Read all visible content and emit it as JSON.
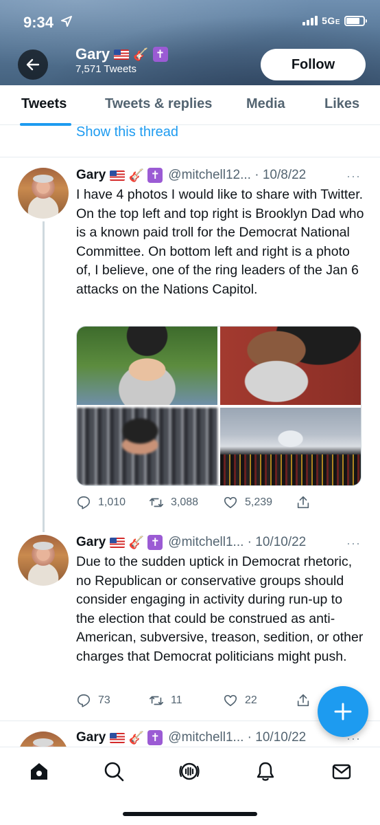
{
  "status_bar": {
    "time": "9:34",
    "network": "5G",
    "network_suffix": "E"
  },
  "profile": {
    "name": "Gary",
    "tweet_count": "7,571 Tweets",
    "follow_label": "Follow"
  },
  "tabs": [
    {
      "label": "Tweets",
      "active": true
    },
    {
      "label": "Tweets & replies",
      "active": false
    },
    {
      "label": "Media",
      "active": false
    },
    {
      "label": "Likes",
      "active": false
    }
  ],
  "show_thread": "Show this thread",
  "tweets": [
    {
      "name": "Gary",
      "handle": "@mitchell12... · 10/8/22",
      "text": "I have 4 photos I would like to share with Twitter. On the top left and top right is Brooklyn Dad who is a known paid troll for the Democrat National Committee. On bottom left and right is a photo of, I believe, one of the ring leaders of the Jan 6 attacks on the Nations Capitol.",
      "replies": "1,010",
      "retweets": "3,088",
      "likes": "5,239"
    },
    {
      "name": "Gary",
      "handle": "@mitchell1... · 10/10/22",
      "text": "Due to the sudden uptick in Democrat rhetoric, no Republican or conservative groups should consider engaging in activity during run-up to the election that could be construed as anti-American, subversive, treason, sedition, or other charges that Democrat politicians might push.",
      "replies": "73",
      "retweets": "11",
      "likes": "22"
    },
    {
      "name": "Gary",
      "handle": "@mitchell1... · 10/10/22"
    }
  ],
  "more_glyph": "···",
  "colors": {
    "accent": "#1d9bf0",
    "text": "#0f1419",
    "muted": "#536471"
  },
  "icons": [
    "back-arrow-icon",
    "location-arrow-icon",
    "reply-icon",
    "retweet-icon",
    "like-icon",
    "share-icon",
    "compose-plus-icon",
    "home-icon",
    "search-icon",
    "spaces-icon",
    "notifications-icon",
    "messages-icon"
  ]
}
